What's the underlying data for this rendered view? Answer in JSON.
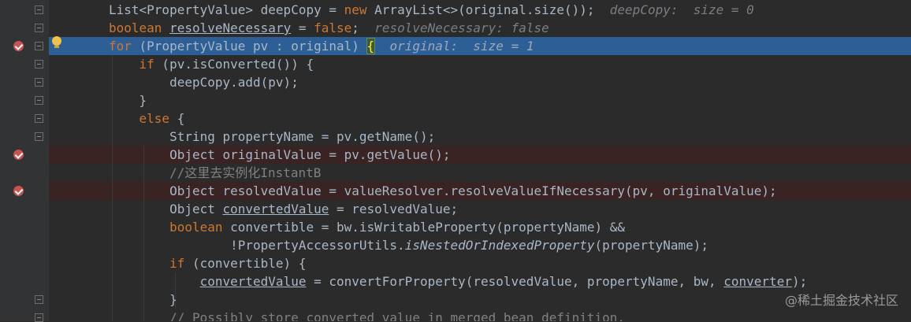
{
  "editor": {
    "lines": [
      {
        "id": "l1",
        "parts": [
          {
            "t": "List<PropertyValue> deepCopy = "
          },
          {
            "t": "new",
            "c": "kw"
          },
          {
            "t": " ArrayList<>(original.size());"
          },
          {
            "t": "  deepCopy:  size = 0",
            "c": "inlay"
          }
        ]
      },
      {
        "id": "l2",
        "parts": [
          {
            "t": "boolean",
            "c": "kw"
          },
          {
            "t": " "
          },
          {
            "t": "resolveNecessary",
            "c": "uline"
          },
          {
            "t": " = "
          },
          {
            "t": "false",
            "c": "kw"
          },
          {
            "t": ";"
          },
          {
            "t": "  resolveNecessary: false",
            "c": "inlay"
          }
        ]
      },
      {
        "id": "l3",
        "current": true,
        "parts": [
          {
            "t": "for",
            "c": "kw"
          },
          {
            "t": " (PropertyValue pv : original) "
          },
          {
            "t": "{",
            "c": "brace-hl"
          },
          {
            "t": "  original:  size = 1",
            "c": "inlay-cur"
          }
        ]
      },
      {
        "id": "l4",
        "parts": [
          {
            "t": "    "
          },
          {
            "t": "if",
            "c": "kw"
          },
          {
            "t": " (pv.isConverted()) {"
          }
        ]
      },
      {
        "id": "l5",
        "parts": [
          {
            "t": "        deepCopy.add(pv);"
          }
        ]
      },
      {
        "id": "l6",
        "parts": [
          {
            "t": "    }"
          }
        ]
      },
      {
        "id": "l7",
        "parts": [
          {
            "t": "    "
          },
          {
            "t": "else",
            "c": "kw"
          },
          {
            "t": " {"
          }
        ]
      },
      {
        "id": "l8",
        "parts": [
          {
            "t": "        String propertyName = pv.getName();"
          }
        ]
      },
      {
        "id": "l9",
        "bp": true,
        "parts": [
          {
            "t": "        Object originalValue = pv.getValue();"
          }
        ]
      },
      {
        "id": "l10",
        "parts": [
          {
            "t": "        //这里去实例化InstantB",
            "c": "cmt"
          }
        ]
      },
      {
        "id": "l11",
        "bp": true,
        "parts": [
          {
            "t": "        Object resolvedValue = valueResolver.resolveValueIfNecessary(pv, originalValue);"
          }
        ]
      },
      {
        "id": "l12",
        "parts": [
          {
            "t": "        Object "
          },
          {
            "t": "convertedValue",
            "c": "uline"
          },
          {
            "t": " = resolvedValue;"
          }
        ]
      },
      {
        "id": "l13",
        "parts": [
          {
            "t": "        "
          },
          {
            "t": "boolean",
            "c": "kw"
          },
          {
            "t": " convertible = bw.isWritableProperty(propertyName) &&"
          }
        ]
      },
      {
        "id": "l14",
        "parts": [
          {
            "t": "                !PropertyAccessorUtils."
          },
          {
            "t": "isNestedOrIndexedProperty",
            "c": "ital"
          },
          {
            "t": "(propertyName);"
          }
        ]
      },
      {
        "id": "l15",
        "parts": [
          {
            "t": "        "
          },
          {
            "t": "if",
            "c": "kw"
          },
          {
            "t": " (convertible) {"
          }
        ]
      },
      {
        "id": "l16",
        "parts": [
          {
            "t": "            "
          },
          {
            "t": "convertedValue",
            "c": "uline"
          },
          {
            "t": " = convertForProperty(resolvedValue, propertyName, bw, "
          },
          {
            "t": "converter",
            "c": "uline"
          },
          {
            "t": ");"
          }
        ]
      },
      {
        "id": "l17",
        "parts": [
          {
            "t": "        }"
          }
        ]
      },
      {
        "id": "l18",
        "parts": [
          {
            "t": "        // Possibly store converted value in merged bean definition.",
            "c": "cmt"
          }
        ]
      }
    ]
  },
  "gutter": {
    "breakpoint_icon": "breakpoint-check-icon",
    "fold_icon": "fold-marker-icon",
    "intention_icon": "lightbulb-icon"
  },
  "colors": {
    "background": "#2b2b2b",
    "current_line": "#2d5e96",
    "breakpoint_line": "#3a2323",
    "keyword": "#cc7832",
    "comment": "#808080"
  },
  "watermark": "@稀土掘金技术社区"
}
